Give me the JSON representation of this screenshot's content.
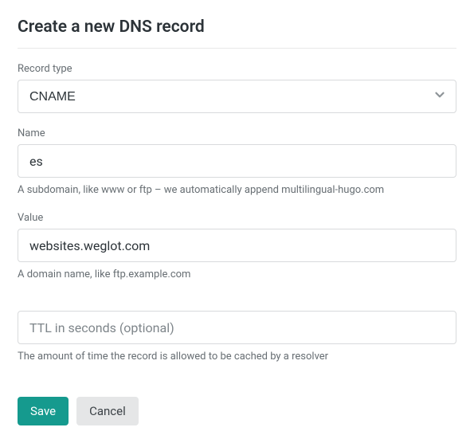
{
  "header": {
    "title": "Create a new DNS record"
  },
  "recordType": {
    "label": "Record type",
    "value": "CNAME"
  },
  "name": {
    "label": "Name",
    "value": "es",
    "help": "A subdomain, like www or ftp – we automatically append multilingual-hugo.com"
  },
  "value": {
    "label": "Value",
    "value": "websites.weglot.com",
    "help": "A domain name, like ftp.example.com"
  },
  "ttl": {
    "placeholder": "TTL in seconds (optional)",
    "value": "",
    "help": "The amount of time the record is allowed to be cached by a resolver"
  },
  "actions": {
    "save": "Save",
    "cancel": "Cancel"
  }
}
